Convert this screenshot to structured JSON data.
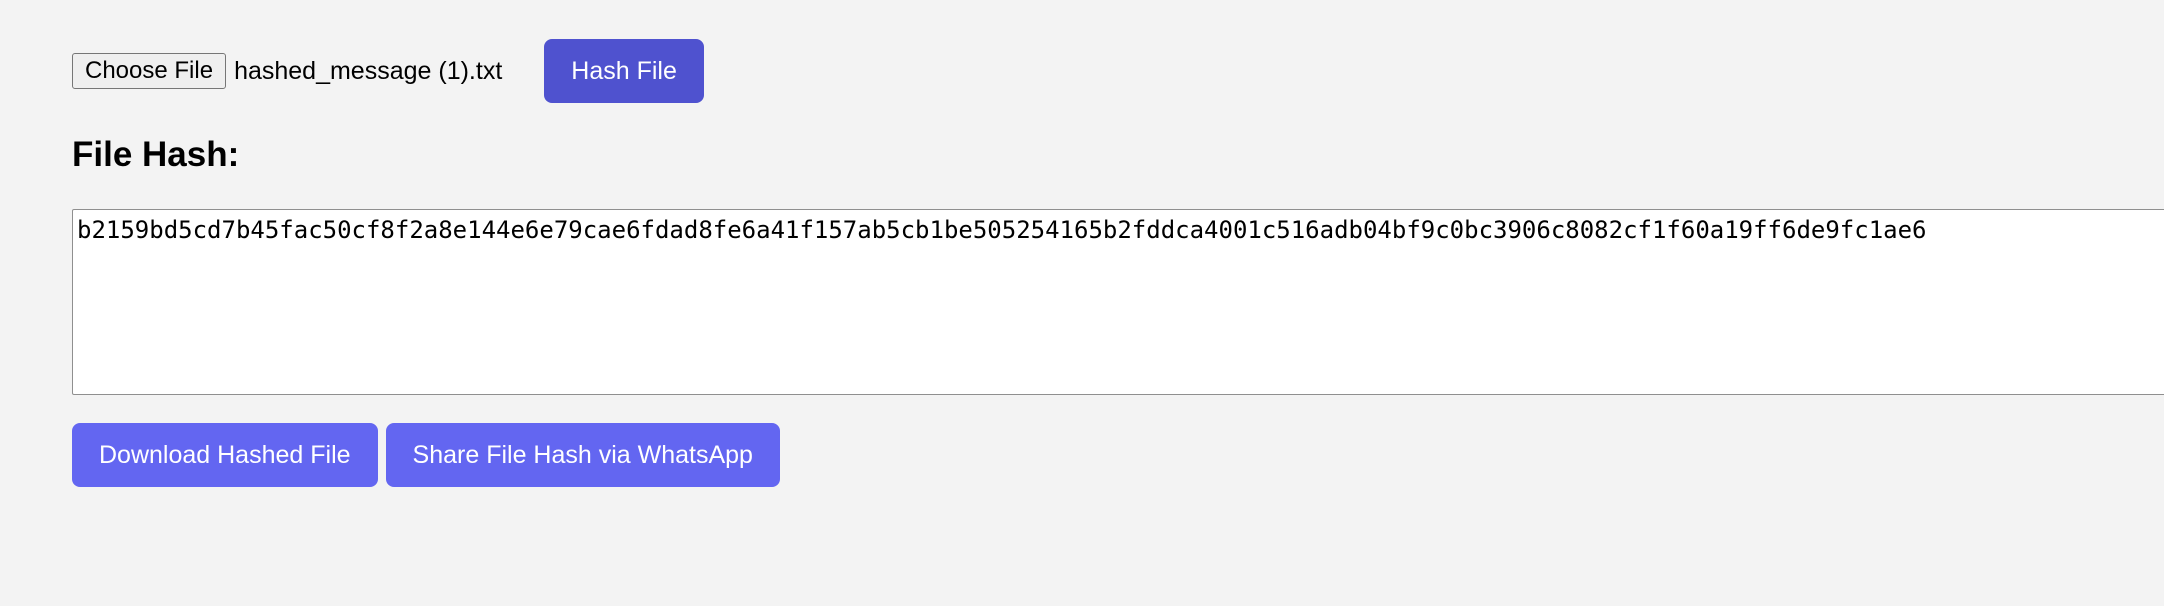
{
  "file_input": {
    "button_label": "Choose File",
    "selected_file": "hashed_message (1).txt"
  },
  "hash_button": {
    "label": "Hash File"
  },
  "result": {
    "title": "File Hash:",
    "hash_value": "b2159bd5cd7b45fac50cf8f2a8e144e6e79cae6fdad8fe6a41f157ab5cb1be505254165b2fddca4001c516adb04bf9c0bc3906c8082cf1f60a19ff6de9fc1ae6"
  },
  "actions": {
    "download_label": "Download Hashed File",
    "share_label": "Share File Hash via WhatsApp"
  },
  "colors": {
    "page_background": "#f3f3f3",
    "hash_button": "#4f52cf",
    "action_buttons": "#6366f1"
  }
}
